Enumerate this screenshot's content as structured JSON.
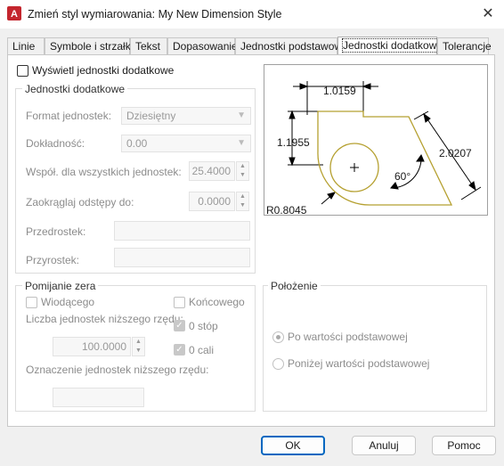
{
  "window": {
    "title": "Zmień styl wymiarowania: My New Dimension Style",
    "close_icon": "close-icon",
    "app_icon": "autocad-icon",
    "accent": "#c4262e"
  },
  "tabs": [
    {
      "label": "Linie"
    },
    {
      "label": "Symbole i strzałki"
    },
    {
      "label": "Tekst"
    },
    {
      "label": "Dopasowanie"
    },
    {
      "label": "Jednostki podstawowe"
    },
    {
      "label": "Jednostki dodatkowe",
      "active": true
    },
    {
      "label": "Tolerancje"
    }
  ],
  "display_alt": {
    "label": "Wyświetl jednostki dodatkowe",
    "checked": false
  },
  "alt_units": {
    "group_label": "Jednostki dodatkowe",
    "format_label": "Format jednostek:",
    "format_value": "Dziesiętny",
    "precision_label": "Dokładność:",
    "precision_value": "0.00",
    "multiplier_label": "Współ. dla wszystkich jednostek:",
    "multiplier_value": "25.4000",
    "round_label": "Zaokrąglaj odstępy do:",
    "round_value": "0.0000",
    "prefix_label": "Przedrostek:",
    "prefix_value": "",
    "suffix_label": "Przyrostek:",
    "suffix_value": ""
  },
  "zero_suppression": {
    "group_label": "Pomijanie zera",
    "leading_label": "Wiodącego",
    "trailing_label": "Końcowego",
    "subunit_factor_label": "Liczba jednostek niższego rzędu:",
    "subunit_factor_value": "100.0000",
    "feet_label": "0 stóp",
    "inches_label": "0 cali",
    "subunit_suffix_label": "Oznaczenie jednostek niższego rzędu:",
    "subunit_suffix_value": ""
  },
  "placement": {
    "group_label": "Położenie",
    "after_primary_label": "Po wartości podstawowej",
    "below_primary_label": "Poniżej wartości podstawowej"
  },
  "preview": {
    "dim_top": "1.0159",
    "dim_left": "1.1955",
    "dim_right": "2.0207",
    "angle": "60°",
    "radius": "R0.8045",
    "outline_color": "#b5a030"
  },
  "buttons": {
    "ok": "OK",
    "cancel": "Anuluj",
    "help": "Pomoc"
  }
}
